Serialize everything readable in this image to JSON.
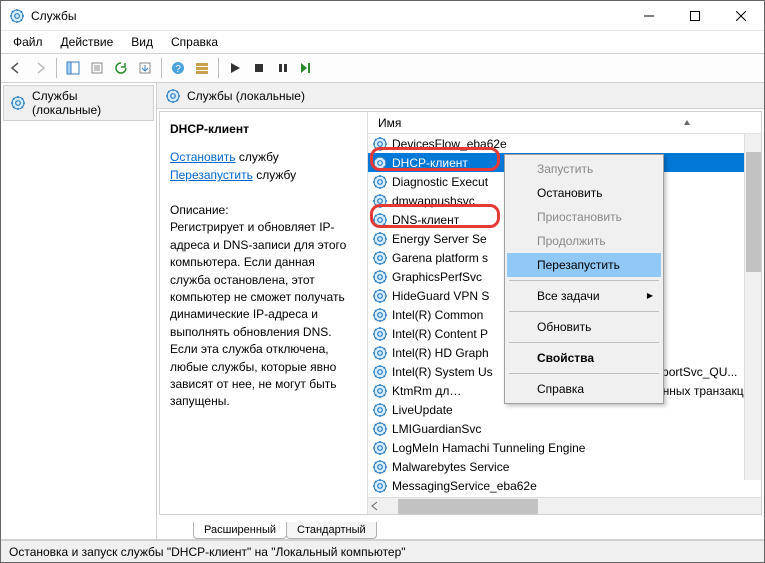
{
  "window": {
    "title": "Службы"
  },
  "menu": {
    "file": "Файл",
    "action": "Действие",
    "view": "Вид",
    "help": "Справка"
  },
  "tree": {
    "root": "Службы (локальные)"
  },
  "right_header": "Службы (локальные)",
  "detail": {
    "name": "DHCP-клиент",
    "stop_link": "Остановить",
    "restart_link": "Перезапустить",
    "svc_word": "службу",
    "desc_label": "Описание:",
    "desc": "Регистрирует и обновляет IP-адреса и DNS-записи для этого компьютера. Если данная служба остановлена, этот компьютер не сможет получать динамические IP-адреса и выполнять обновления DNS. Если эта служба отключена, любые службы, которые явно зависят от нее, не могут быть запущены."
  },
  "column": "Имя",
  "services": [
    {
      "name": "DevicesFlow_eba62e",
      "sel": false
    },
    {
      "name": "DHCP-клиент",
      "sel": true
    },
    {
      "name": "Diagnostic Execut",
      "sel": false
    },
    {
      "name": "dmwappushsvc",
      "sel": false
    },
    {
      "name": "DNS-клиент",
      "sel": false
    },
    {
      "name": "Energy Server Se",
      "sel": false
    },
    {
      "name": "Garena platform s",
      "sel": false
    },
    {
      "name": "GraphicsPerfSvc",
      "sel": false
    },
    {
      "name": "HideGuard VPN S",
      "sel": false
    },
    {
      "name": "Intel(R) Common",
      "sel": false
    },
    {
      "name": "Intel(R) Content P",
      "sel": false
    },
    {
      "name": "Intel(R) HD Graph",
      "sel": false
    },
    {
      "name": "Intel(R) System Us",
      "sel": false,
      "tail": "ReportSvc_QU..."
    },
    {
      "name": "KtmRm для коорд",
      "sel": false,
      "tail": "пределинных транзакций"
    },
    {
      "name": "LiveUpdate",
      "sel": false
    },
    {
      "name": "LMIGuardianSvc",
      "sel": false
    },
    {
      "name": "LogMeIn Hamachi Tunneling Engine",
      "sel": false
    },
    {
      "name": "Malwarebytes Service",
      "sel": false
    },
    {
      "name": "MessagingService_eba62e",
      "sel": false
    }
  ],
  "context": {
    "start": "Запустить",
    "stop": "Остановить",
    "pause": "Приостановить",
    "resume": "Продолжить",
    "restart": "Перезапустить",
    "alltasks": "Все задачи",
    "refresh": "Обновить",
    "properties": "Свойства",
    "help": "Справка"
  },
  "tabs": {
    "extended": "Расширенный",
    "standard": "Стандартный"
  },
  "status": "Остановка и запуск службы \"DHCP-клиент\" на \"Локальный компьютер\""
}
